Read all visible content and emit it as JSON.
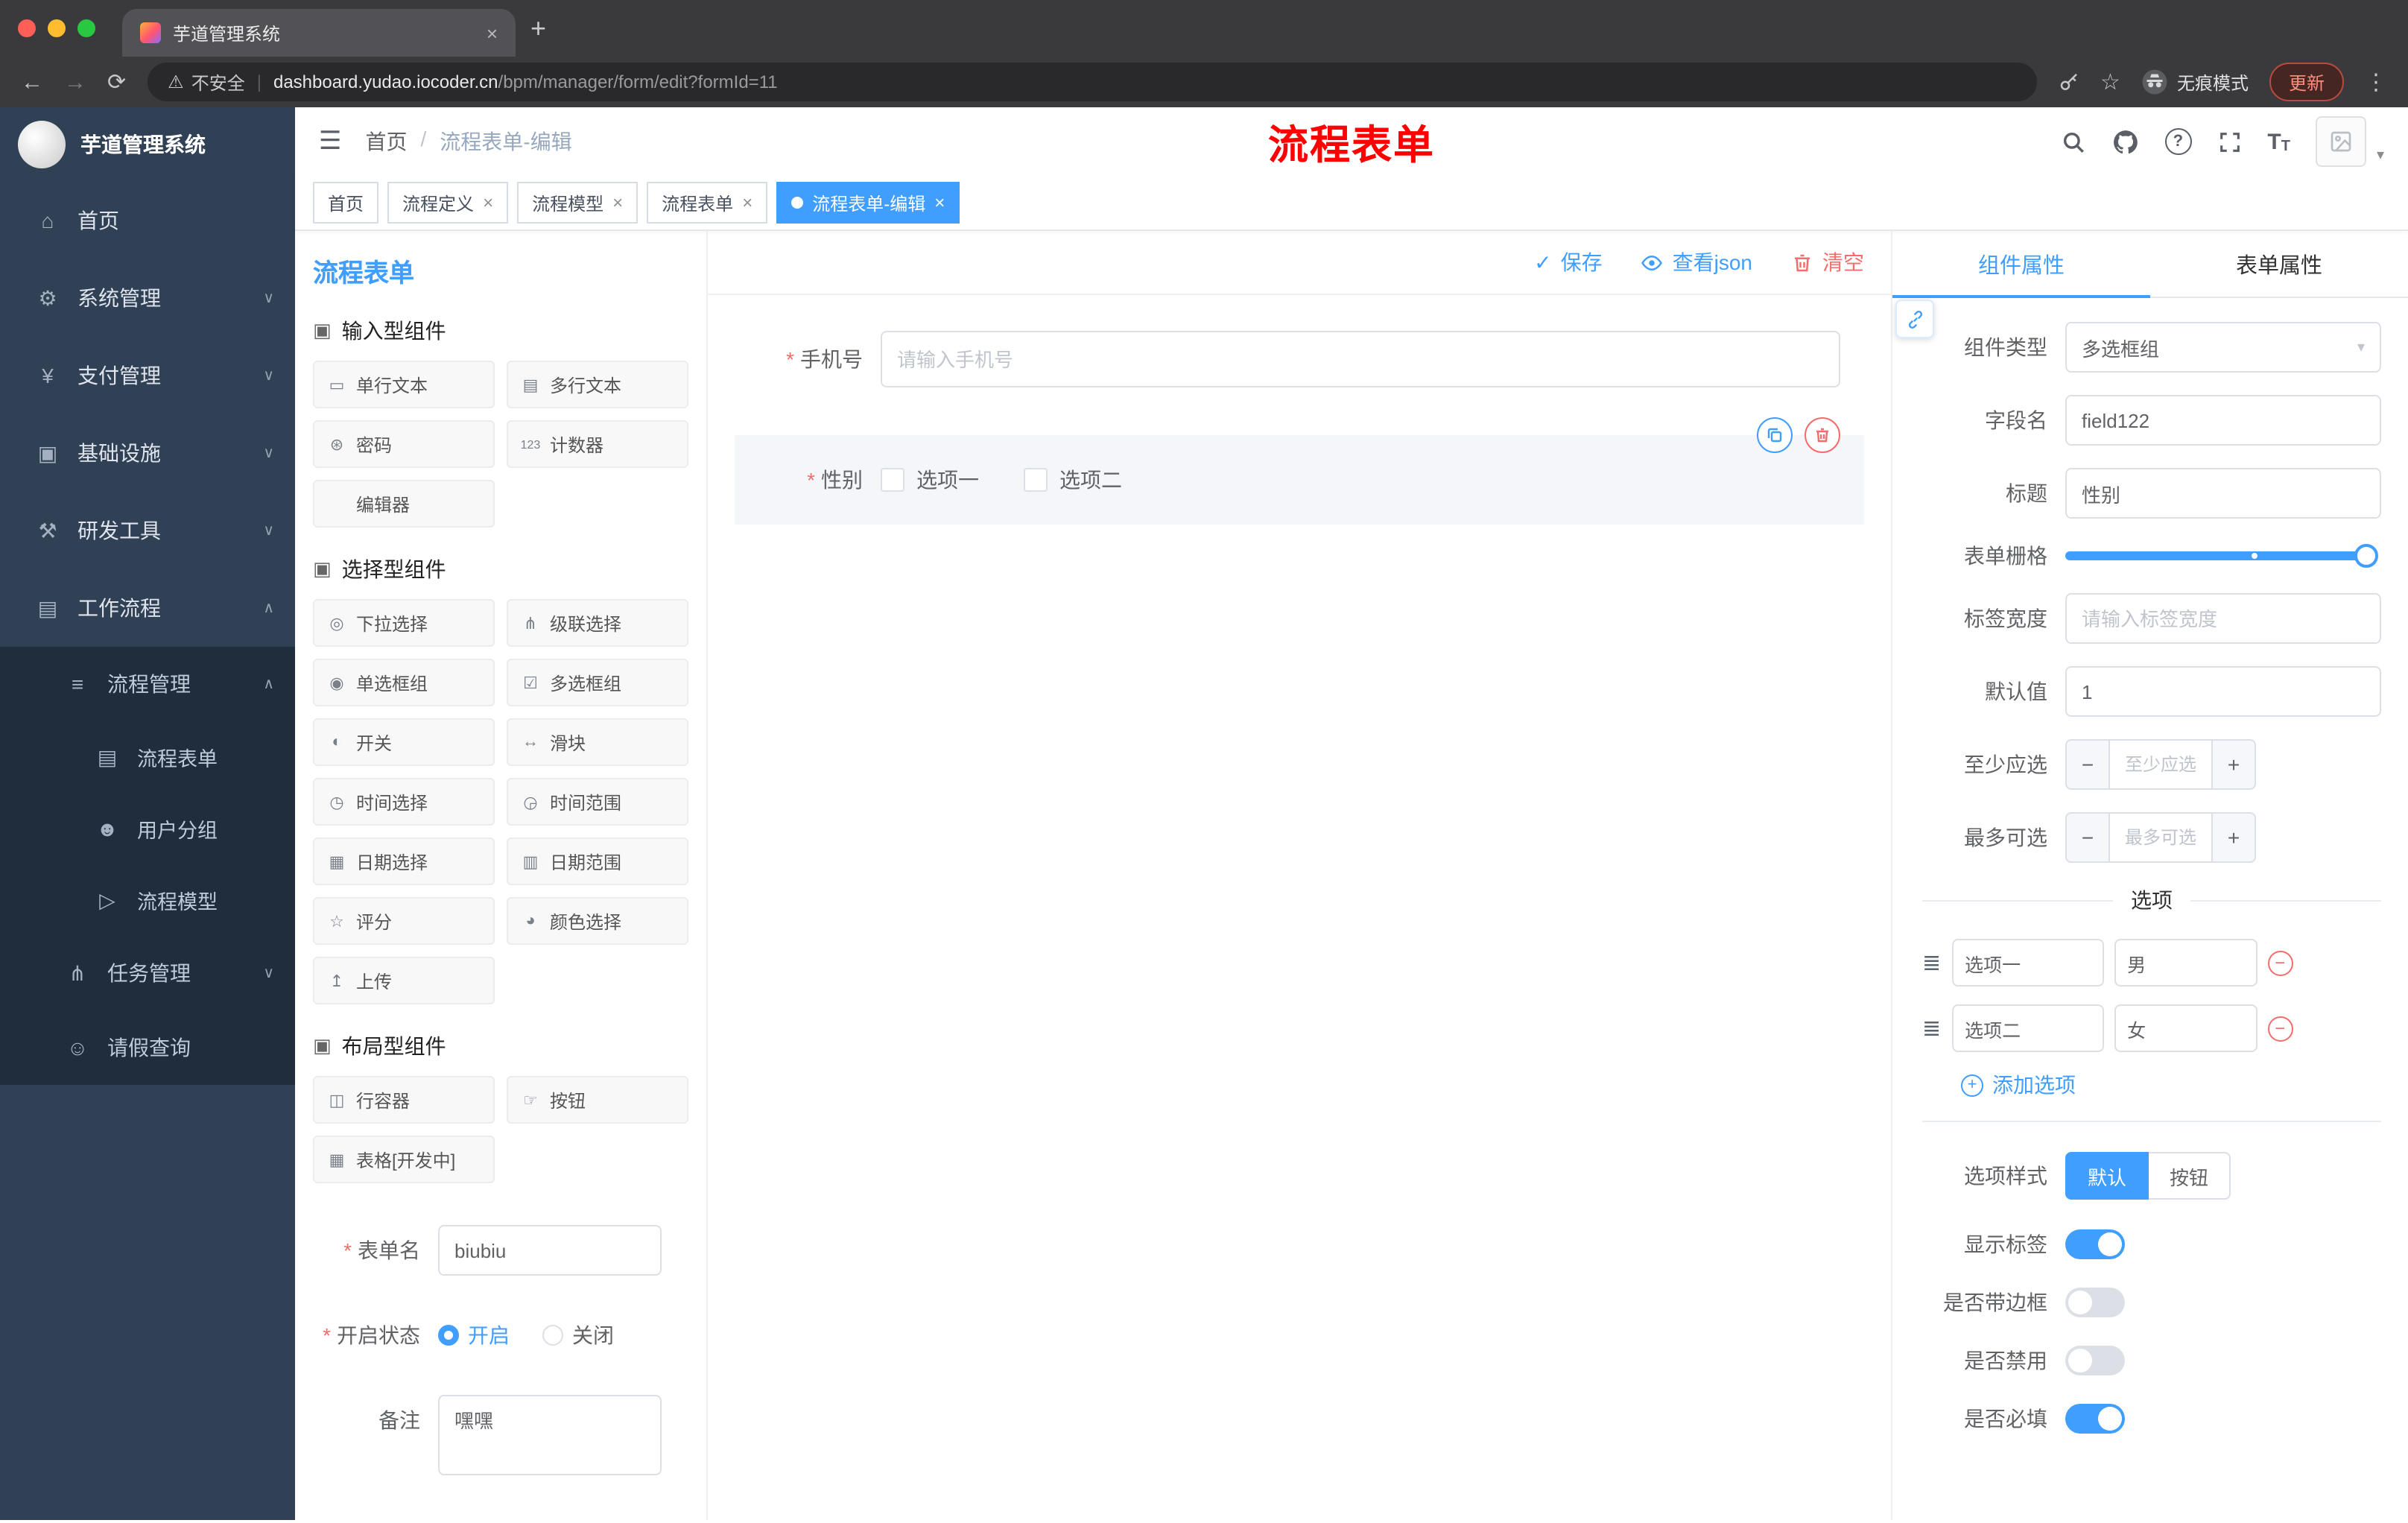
{
  "glyphs": {
    "close": "×",
    "plus": "+",
    "hamburger": "☰",
    "caret_down": "▾",
    "back": "←",
    "forward": "→",
    "reload": "⟳",
    "warning": "⚠",
    "star": "☆",
    "kebab": "⋮",
    "check": "✓",
    "minus": "−",
    "sep": "/",
    "question": "?",
    "t_large": "T",
    "t_small": "T"
  },
  "colors": {
    "accent": "#409eff",
    "danger": "#f56c6c",
    "annotation": "#fe0100",
    "sidebar": "#304156",
    "sidebar_sub": "#1f2d3d"
  },
  "browser": {
    "tab_title": "芋道管理系统",
    "security": "不安全",
    "url_host": "dashboard.yudao.iocoder.cn",
    "url_path": "/bpm/manager/form/edit?formId=11",
    "incognito": "无痕模式",
    "update": "更新"
  },
  "sidebar": {
    "title": "芋道管理系统",
    "items": [
      {
        "label": "首页",
        "glyph": "⌂"
      },
      {
        "label": "系统管理",
        "glyph": "⚙",
        "chevron": "∨"
      },
      {
        "label": "支付管理",
        "glyph": "¥",
        "chevron": "∨"
      },
      {
        "label": "基础设施",
        "glyph": "▣",
        "chevron": "∨"
      },
      {
        "label": "研发工具",
        "glyph": "⚒",
        "chevron": "∨"
      },
      {
        "label": "工作流程",
        "glyph": "▤",
        "chevron": "∧"
      },
      {
        "label": "流程管理",
        "glyph": "≡",
        "chevron": "∧"
      },
      {
        "label": "流程表单",
        "glyph": "▤"
      },
      {
        "label": "用户分组",
        "glyph": "☻"
      },
      {
        "label": "流程模型",
        "glyph": "▷"
      },
      {
        "label": "任务管理",
        "glyph": "⋔",
        "chevron": "∨"
      },
      {
        "label": "请假查询",
        "glyph": "☺"
      }
    ]
  },
  "header": {
    "breadcrumb_home": "首页",
    "breadcrumb_current": "流程表单-编辑",
    "annotation": "流程表单"
  },
  "tags": [
    {
      "label": "首页"
    },
    {
      "label": "流程定义"
    },
    {
      "label": "流程模型"
    },
    {
      "label": "流程表单"
    },
    {
      "label": "流程表单-编辑"
    }
  ],
  "palette": {
    "title": "流程表单",
    "groups": [
      {
        "name": "输入型组件",
        "glyph": "▣",
        "items": [
          {
            "label": "单行文本",
            "glyph": "▭"
          },
          {
            "label": "多行文本",
            "glyph": "▤"
          },
          {
            "label": "密码",
            "glyph": "⊛"
          },
          {
            "label": "计数器",
            "glyph": "123"
          },
          {
            "label": "编辑器",
            "glyph": ""
          }
        ]
      },
      {
        "name": "选择型组件",
        "glyph": "▣",
        "items": [
          {
            "label": "下拉选择",
            "glyph": "◎"
          },
          {
            "label": "级联选择",
            "glyph": "⋔"
          },
          {
            "label": "单选框组",
            "glyph": "◉"
          },
          {
            "label": "多选框组",
            "glyph": "☑"
          },
          {
            "label": "开关",
            "glyph": "◐"
          },
          {
            "label": "滑块",
            "glyph": "↔"
          },
          {
            "label": "时间选择",
            "glyph": "◷"
          },
          {
            "label": "时间范围",
            "glyph": "◶"
          },
          {
            "label": "日期选择",
            "glyph": "▦"
          },
          {
            "label": "日期范围",
            "glyph": "▥"
          },
          {
            "label": "评分",
            "glyph": "☆"
          },
          {
            "label": "颜色选择",
            "glyph": "◕"
          },
          {
            "label": "上传",
            "glyph": "↥"
          }
        ]
      },
      {
        "name": "布局型组件",
        "glyph": "▣",
        "items": [
          {
            "label": "行容器",
            "glyph": "◫"
          },
          {
            "label": "按钮",
            "glyph": "☞"
          },
          {
            "label": "表格[开发中]",
            "glyph": "▦"
          }
        ]
      }
    ],
    "form": {
      "name_label": "表单名",
      "name_value": "biubiu",
      "status_label": "开启状态",
      "on": "开启",
      "off": "关闭",
      "remark_label": "备注",
      "remark_value": "嘿嘿"
    }
  },
  "canvas": {
    "actions": {
      "save": "保存",
      "view_json": "查看json",
      "clear": "清空"
    },
    "phone": {
      "label": "手机号",
      "placeholder": "请输入手机号"
    },
    "gender": {
      "label": "性别",
      "options": [
        "选项一",
        "选项二"
      ]
    }
  },
  "inspector": {
    "tabs": [
      "组件属性",
      "表单属性"
    ],
    "type_label": "组件类型",
    "type_value": "多选框组",
    "field_label": "字段名",
    "field_value": "field122",
    "title_label": "标题",
    "title_value": "性别",
    "grid_label": "表单栅格",
    "width_label": "标签宽度",
    "width_placeholder": "请输入标签宽度",
    "default_label": "默认值",
    "default_value": "1",
    "min_label": "至少应选",
    "min_placeholder": "至少应选",
    "max_label": "最多可选",
    "max_placeholder": "最多可选",
    "options_title": "选项",
    "options": [
      {
        "label": "选项一",
        "value": "男"
      },
      {
        "label": "选项二",
        "value": "女"
      }
    ],
    "add_option": "添加选项",
    "style_label": "选项样式",
    "style_default": "默认",
    "style_button": "按钮",
    "switches": [
      {
        "label": "显示标签",
        "on": true
      },
      {
        "label": "是否带边框",
        "on": false
      },
      {
        "label": "是否禁用",
        "on": false
      },
      {
        "label": "是否必填",
        "on": true
      }
    ]
  }
}
